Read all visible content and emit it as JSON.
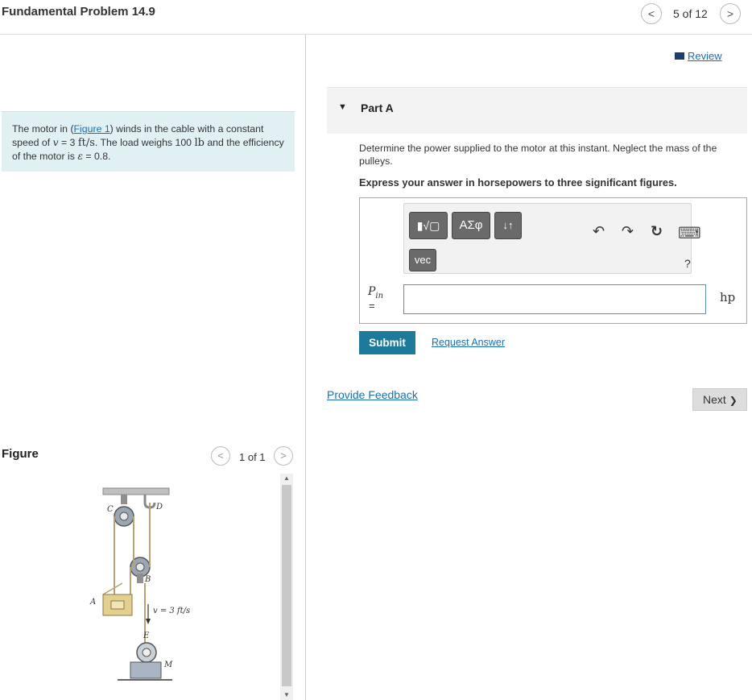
{
  "header": {
    "title": "Fundamental Problem 14.9",
    "pager": "5 of 12",
    "prev_glyph": "<",
    "next_glyph": ">"
  },
  "problem": {
    "t1": "The motor in (",
    "figure_link": "Figure 1",
    "t2": ") winds in the cable with a constant speed of ",
    "v": "v",
    "t3": " = 3 ",
    "speed_unit": "ft/s",
    "t4": ". The load weighs 100 ",
    "weight_unit": "lb",
    "t5": " and the efficiency of the motor is ",
    "eps": "ε",
    "t6": " = 0.8."
  },
  "figure": {
    "label": "Figure",
    "pager": "1 of 1",
    "labels": {
      "C": "C",
      "D": "D",
      "B": "B",
      "A": "A",
      "E": "E",
      "M": "M",
      "speed": "v = 3 ft/s"
    }
  },
  "review": {
    "label": "Review"
  },
  "part": {
    "caret": "▼",
    "title": "Part A",
    "question": "Determine the power supplied to the motor at this instant. Neglect the mass of the pulleys.",
    "instruction": "Express your answer in horsepowers to three significant figures."
  },
  "toolbar": {
    "templates": "▮√▢",
    "greek": "ΑΣφ",
    "arrows": "↓↑",
    "vec": "vec",
    "undo": "↶",
    "redo": "↷",
    "reset": "↻",
    "keyboard": "⌨",
    "help": "?"
  },
  "answer": {
    "var": "P",
    "sub": "in",
    "eq": "=",
    "value": "",
    "unit": "hp"
  },
  "actions": {
    "submit": "Submit",
    "request": "Request Answer",
    "feedback": "Provide Feedback",
    "next": "Next",
    "next_glyph": "❯"
  }
}
